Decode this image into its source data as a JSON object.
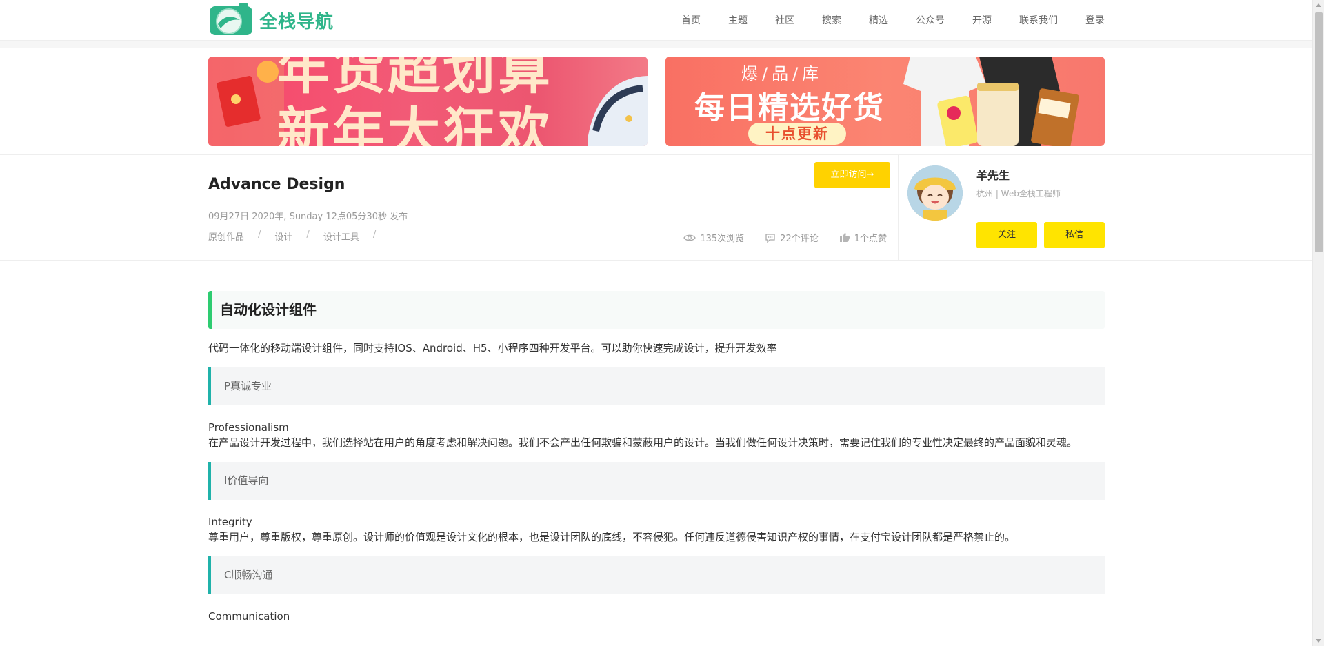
{
  "header": {
    "logo_text": "全栈导航",
    "nav": [
      "首页",
      "主题",
      "社区",
      "搜索",
      "精选",
      "公众号",
      "开源",
      "联系我们",
      "登录"
    ]
  },
  "banners": {
    "left": {
      "line1": "年货超划算",
      "line2": "新年大狂欢"
    },
    "right": {
      "top": "爆/品/库",
      "main": "每日精选好货",
      "pill": "十点更新"
    }
  },
  "article": {
    "title": "Advance Design",
    "publish": "09月27日 2020年, Sunday 12点05分30秒 发布",
    "crumbs": [
      "原创作品",
      "设计",
      "设计工具"
    ],
    "crumb_sep": "/",
    "visit_label": "立即访问→",
    "stats": {
      "views": "135次浏览",
      "comments": "22个评论",
      "likes": "1个点赞"
    }
  },
  "author": {
    "name": "羊先生",
    "meta": "杭州 | Web全栈工程师",
    "follow_label": "关注",
    "message_label": "私信"
  },
  "content": {
    "heading": "自动化设计组件",
    "lead": "代码一体化的移动端设计组件，同时支持IOS、Android、H5、小程序四种开发平台。可以助你快速完成设计，提升开发效率",
    "sections": [
      {
        "quote": "P真诚专业",
        "title": "Professionalism",
        "body": "在产品设计开发过程中，我们选择站在用户的角度考虑和解决问题。我们不会产出任何欺骗和蒙蔽用户的设计。当我们做任何设计决策时，需要记住我们的专业性决定最终的产品面貌和灵魂。"
      },
      {
        "quote": "I价值导向",
        "title": "Integrity",
        "body": "尊重用户，尊重版权，尊重原创。设计师的价值观是设计文化的根本，也是设计团队的底线，不容侵犯。任何违反道德侵害知识产权的事情，在支付宝设计团队都是严格禁止的。"
      },
      {
        "quote": "C顺畅沟通",
        "title": "Communication"
      }
    ]
  },
  "colors": {
    "brand_green": "#2fb58a",
    "accent_yellow": "#ffd200",
    "heading_bar": "#2ecc71",
    "quote_bar": "#20b2aa"
  }
}
